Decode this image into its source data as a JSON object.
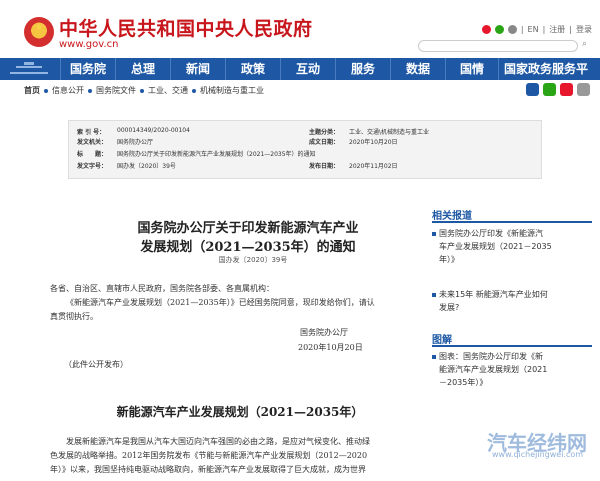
{
  "header": {
    "site_title": "中华人民共和国中央人民政府",
    "domain": "www.gov.cn",
    "links": [
      "|",
      "EN",
      "|",
      "注册",
      "|",
      "登录"
    ]
  },
  "nav": {
    "items": [
      "国务院",
      "总理",
      "新闻",
      "政策",
      "互动",
      "服务",
      "数据",
      "国情",
      "国家政务服务平台"
    ]
  },
  "breadcrumb": [
    "首页",
    "信息公开",
    "国务院文件",
    "工业、交通",
    "机械制造与重工业"
  ],
  "infobox": {
    "index_label": "索 引 号：",
    "index_value": "000014349/2020-00104",
    "issuer_label": "发文机关：",
    "issuer_value": "国务院办公厅",
    "title_label": "标　　题：",
    "title_value": "国务院办公厅关于印发新能源汽车产业发展规划（2021—2035年）的通知",
    "docno_label": "发文字号：",
    "docno_value": "国办发〔2020〕39号",
    "topic_label": "主题分类：",
    "topic_value": "工业、交通\\机械制造与重工业",
    "date_label": "成文日期：",
    "date_value": "2020年10月20日",
    "pub_label": "发布日期：",
    "pub_value": "2020年11月02日"
  },
  "document": {
    "title_line1": "国务院办公厅关于印发新能源汽车产业",
    "title_line2": "发展规划（2021—2035年）的通知",
    "doc_no": "国办发〔2020〕39号",
    "salutation": "各省、自治区、直辖市人民政府，国务院各部委、各直属机构：",
    "body_1": "《新能源汽车产业发展规划（2021—2035年）》已经国务院同意，现印发给你们，请认",
    "body_2": "真贯彻执行。",
    "signer": "国务院办公厅",
    "sign_date": "2020年10月20日",
    "publish_note": "（此件公开发布）",
    "plan_title": "新能源汽车产业发展规划（2021—2035年）",
    "plan_p1": "发展新能源汽车是我国从汽车大国迈向汽车强国的必由之路，是应对气候变化、推动绿",
    "plan_p2": "色发展的战略举措。2012年国务院发布《节能与新能源汽车产业发展规划（2012—2020",
    "plan_p3": "年）》以来，我国坚持纯电驱动战略取向，新能源汽车产业发展取得了巨大成就，成为世界"
  },
  "sidebar": {
    "related_heading": "相关报道",
    "related_1a": "国务院办公厅印发《新能源汽",
    "related_1b": "车产业发展规划（2021－2035",
    "related_1c": "年）》",
    "related_2a": "未来15年 新能源汽车产业如何",
    "related_2b": "发展?",
    "graphic_heading": "图解",
    "graphic_1a": "图表：国务院办公厅印发《新",
    "graphic_1b": "能源汽车产业发展规划（2021",
    "graphic_1c": "－2035年）》"
  },
  "watermark": {
    "brand": "汽车经纬网",
    "url": "www.qichejingwei.com"
  },
  "colors": {
    "brand_red": "#c8161d",
    "nav_blue": "#1e58a4"
  }
}
